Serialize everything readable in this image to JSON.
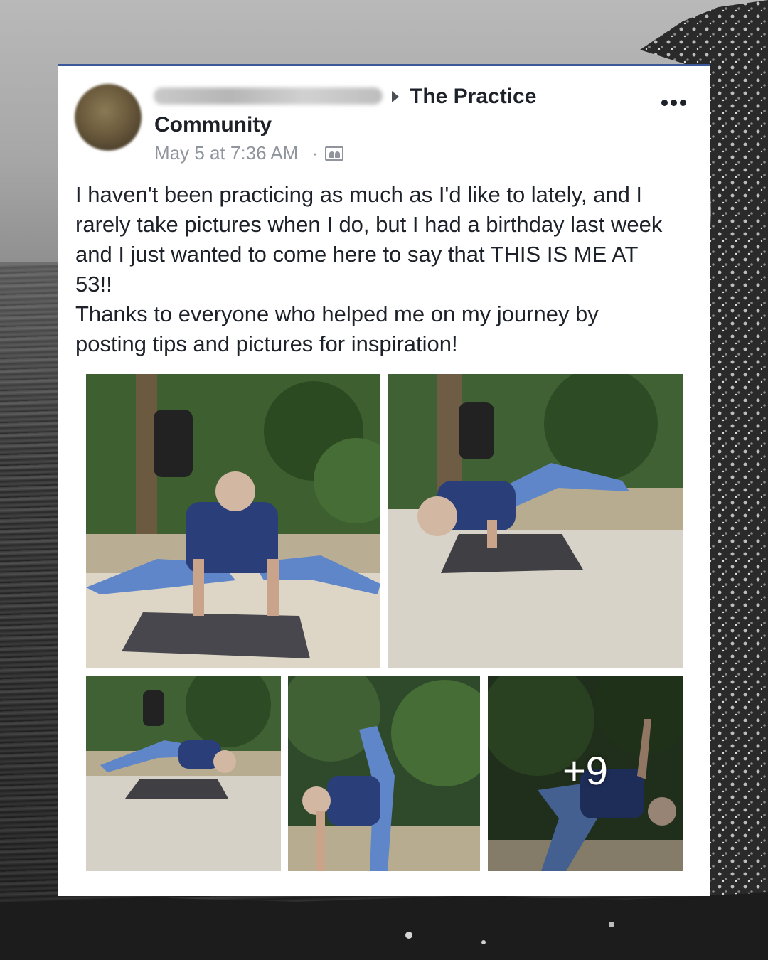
{
  "post": {
    "group_name_line1": "The Practice",
    "group_name_line2": "Community",
    "timestamp": "May 5 at 7:36 AM",
    "separator": "·",
    "text": "I haven't been practicing as much as I'd like to lately, and I\nrarely take pictures when I do, but I had a birthday last week\nand I just wanted to come here to say that THIS IS ME AT\n53!!\nThanks to everyone who helped me on my journey by\nposting tips and pictures for inspiration!",
    "more_photos_label": "+9",
    "icons": {
      "options": "more-options-icon",
      "audience": "group-audience-icon",
      "caret": "caret-right-icon"
    }
  },
  "colors": {
    "accent": "#3b5998",
    "text": "#1d2129",
    "meta": "#90949c"
  }
}
